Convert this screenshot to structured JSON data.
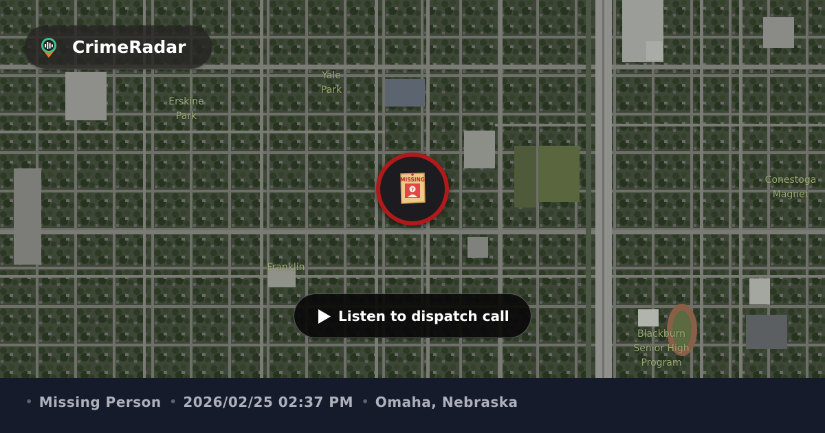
{
  "brand": {
    "name": "CrimeRadar",
    "logo_icon": "radar-pin-icon"
  },
  "map": {
    "style": "satellite",
    "labels": [
      {
        "id": "yale",
        "lines": [
          "Yale",
          "Park"
        ]
      },
      {
        "id": "erskine",
        "lines": [
          "Erskine",
          "Park"
        ]
      },
      {
        "id": "conestoga",
        "lines": [
          "Conestoga",
          "Magnet"
        ]
      },
      {
        "id": "franklin",
        "lines": [
          "Franklin"
        ]
      },
      {
        "id": "blackburn",
        "lines": [
          "Blackburn",
          "Senior High",
          "Program"
        ]
      }
    ]
  },
  "incident": {
    "icon": "missing-poster-icon",
    "icon_text": "MISSING",
    "pin_color": "#b01a1a"
  },
  "dispatch_button": {
    "label": "Listen to dispatch call",
    "icon": "play-icon"
  },
  "footer": {
    "type": "Missing Person",
    "datetime": "2026/02/25 02:37 PM",
    "location": "Omaha, Nebraska"
  },
  "colors": {
    "footer_bg": "#161b2c",
    "footer_text": "#aeb1bc",
    "map_label": "#9aa86e",
    "button_bg": "#0a0a0a"
  }
}
